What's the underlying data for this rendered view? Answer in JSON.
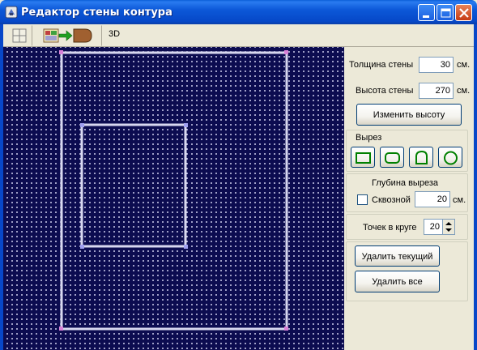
{
  "window": {
    "title": "Редактор стены контура",
    "accent": "#0a5fd8"
  },
  "toolbar": {
    "items": [
      {
        "name": "grid",
        "icon": "grid-icon"
      },
      {
        "name": "convert",
        "icon": "convert-arrow-icon"
      },
      {
        "name": "3d",
        "label": "3D"
      }
    ]
  },
  "canvas": {
    "background": "#0c0c50",
    "line_color": "#d8d8f0"
  },
  "panel": {
    "wall_thickness": {
      "label": "Толщина стены",
      "value": "30",
      "unit": "см."
    },
    "wall_height": {
      "label": "Высота стены",
      "value": "270",
      "unit": "см."
    },
    "change_height_button": "Изменить высоту",
    "cutout": {
      "legend": "Вырез",
      "shapes": [
        "rectangle-icon",
        "rounded-rectangle-icon",
        "arch-icon",
        "circle-icon"
      ],
      "shape_color": "#008000"
    },
    "depth": {
      "title": "Глубина выреза",
      "through_label": "Сквозной",
      "through_checked": false,
      "value": "20",
      "unit": "см."
    },
    "circle_points": {
      "label": "Точек в круге",
      "value": "20"
    },
    "delete_current_button": "Удалить текущий",
    "delete_all_button": "Удалить все"
  }
}
